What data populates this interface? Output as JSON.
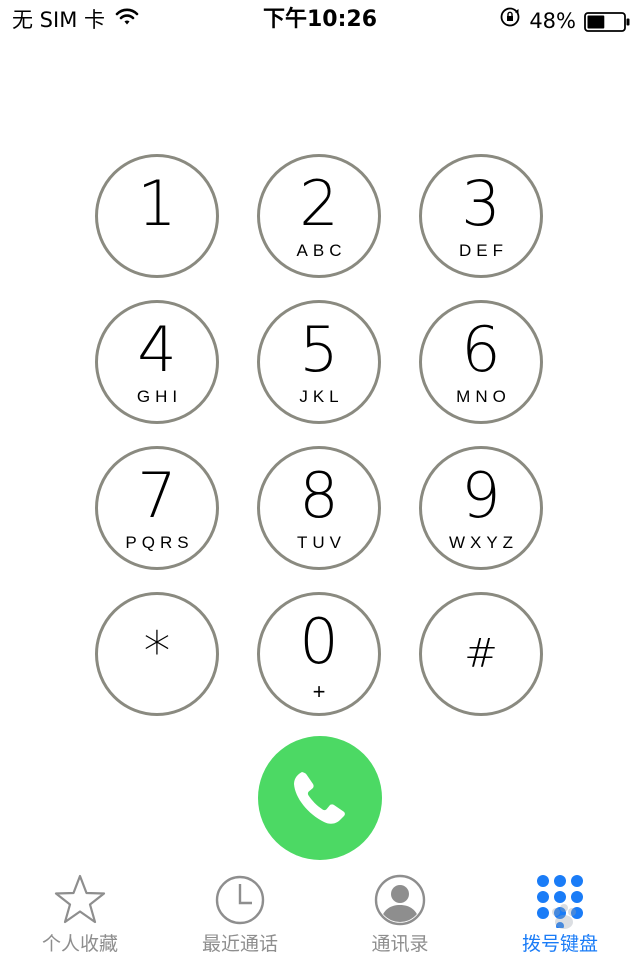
{
  "status_bar": {
    "carrier": "无 SIM 卡",
    "time": "下午10:26",
    "battery_percent": "48%",
    "battery_level": 0.48,
    "icons": [
      "wifi-icon",
      "rotation-lock-icon",
      "battery-icon"
    ]
  },
  "keypad": {
    "keys": [
      {
        "digit": "1",
        "letters": ""
      },
      {
        "digit": "2",
        "letters": "ABC"
      },
      {
        "digit": "3",
        "letters": "DEF"
      },
      {
        "digit": "4",
        "letters": "GHI"
      },
      {
        "digit": "5",
        "letters": "JKL"
      },
      {
        "digit": "6",
        "letters": "MNO"
      },
      {
        "digit": "7",
        "letters": "PQRS"
      },
      {
        "digit": "8",
        "letters": "TUV"
      },
      {
        "digit": "9",
        "letters": "WXYZ"
      },
      {
        "digit": "*",
        "letters": ""
      },
      {
        "digit": "0",
        "letters": "+"
      },
      {
        "digit": "#",
        "letters": ""
      }
    ],
    "call_icon": "phone-icon"
  },
  "tab_bar": {
    "tabs": [
      {
        "label": "个人收藏",
        "icon": "star-icon",
        "active": false
      },
      {
        "label": "最近通话",
        "icon": "clock-icon",
        "active": false
      },
      {
        "label": "通讯录",
        "icon": "contact-icon",
        "active": false
      },
      {
        "label": "拨号键盘",
        "icon": "keypad-icon",
        "active": true
      }
    ]
  },
  "colors": {
    "key_border": "#8a8a80",
    "call_green": "#4cd964",
    "active_blue": "#1a7cf7",
    "inactive_gray": "#8e8e8e"
  }
}
